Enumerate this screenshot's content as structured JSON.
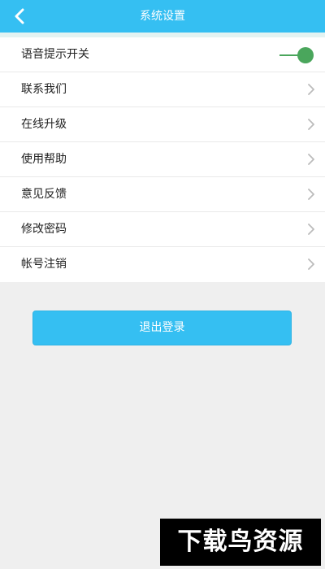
{
  "colors": {
    "header": "#35bff2",
    "toggle_on": "#4aa65c",
    "button": "#35bff2",
    "background": "#efefef"
  },
  "header": {
    "title": "系统设置",
    "back_icon": "chevron-left-icon"
  },
  "settings": {
    "voice_toggle": {
      "label": "语音提示开关",
      "on": true
    },
    "items": [
      {
        "label": "联系我们"
      },
      {
        "label": "在线升级"
      },
      {
        "label": "使用帮助"
      },
      {
        "label": "意见反馈"
      },
      {
        "label": "修改密码"
      },
      {
        "label": "帐号注销"
      }
    ]
  },
  "logout": {
    "label": "退出登录"
  },
  "watermark": {
    "text": "下载鸟资源"
  }
}
